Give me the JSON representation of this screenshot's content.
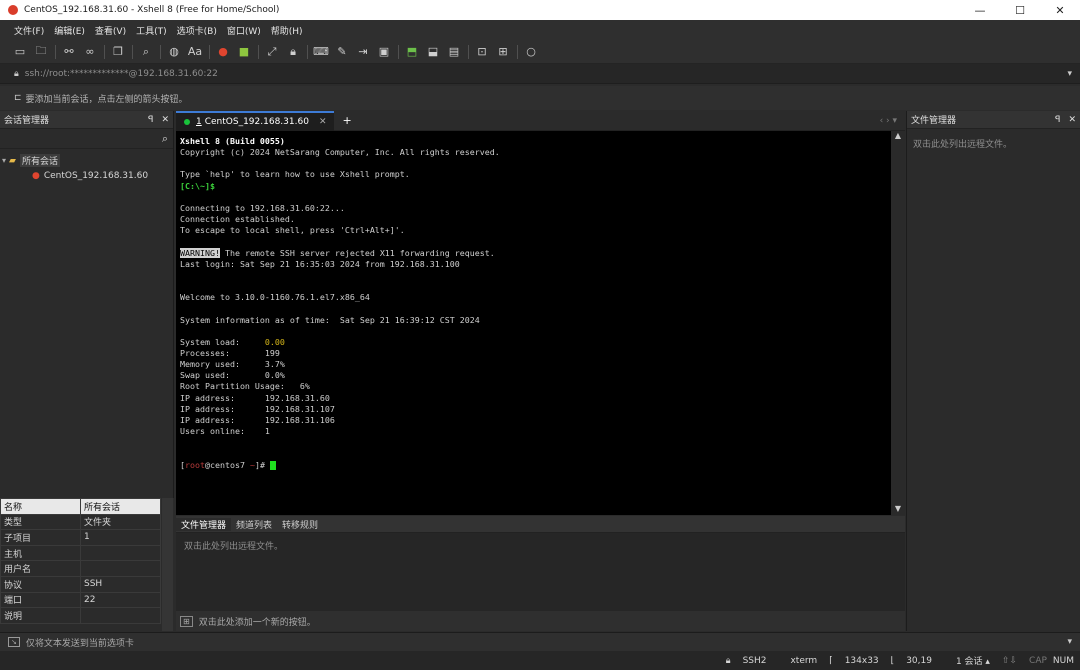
{
  "window": {
    "title": "CentOS_192.168.31.60 - Xshell 8 (Free for Home/School)",
    "minimize": "—",
    "maximize": "☐",
    "close": "✕"
  },
  "menu": [
    "文件(F)",
    "编辑(E)",
    "查看(V)",
    "工具(T)",
    "选项卡(B)",
    "窗口(W)",
    "帮助(H)"
  ],
  "toolbar": {
    "icons": [
      "new-session-icon",
      "open-folder-icon",
      "disconnect-icon",
      "reconnect-icon",
      "copy-icon",
      "find-icon",
      "globe-icon",
      "font-icon",
      "xshell-icon",
      "xftp-icon",
      "fullscreen-icon",
      "lock-icon",
      "keyboard-icon",
      "compose-icon",
      "script-icon",
      "help-icon",
      "transfer-icon",
      "tile-icon",
      "tabs-icon",
      "layout-icon",
      "chat-icon"
    ],
    "font_label": "Aa"
  },
  "address": {
    "value": "ssh://root:*************@192.168.31.60:22"
  },
  "hint": {
    "text": "要添加当前会话，点击左侧的箭头按钮。"
  },
  "session_manager": {
    "title": "会话管理器",
    "tree": {
      "root": "所有会话",
      "items": [
        "CentOS_192.168.31.60"
      ]
    }
  },
  "properties": {
    "header": [
      "名称",
      "所有会话"
    ],
    "rows": [
      [
        "类型",
        "文件夹"
      ],
      [
        "子项目",
        "1"
      ],
      [
        "主机",
        ""
      ],
      [
        "用户名",
        ""
      ],
      [
        "协议",
        "SSH"
      ],
      [
        "端口",
        "22"
      ],
      [
        "说明",
        ""
      ]
    ]
  },
  "tab": {
    "index": "1",
    "label": "CentOS_192.168.31.60",
    "add": "+"
  },
  "terminal": {
    "lines": [
      {
        "t": "Xshell 8 (Build 0055)",
        "c": "b"
      },
      {
        "t": "Copyright (c) 2024 NetSarang Computer, Inc. All rights reserved.",
        "c": ""
      },
      {
        "t": "",
        "c": ""
      },
      {
        "t": "Type `help' to learn how to use Xshell prompt.",
        "c": ""
      },
      {
        "t": "[C:\\~]$",
        "c": "g"
      },
      {
        "t": "",
        "c": ""
      },
      {
        "t": "Connecting to 192.168.31.60:22...",
        "c": ""
      },
      {
        "t": "Connection established.",
        "c": ""
      },
      {
        "t": "To escape to local shell, press 'Ctrl+Alt+]'.",
        "c": ""
      },
      {
        "t": "",
        "c": ""
      },
      {
        "t": "WARNING! The remote SSH server rejected X11 forwarding request.",
        "c": "warn"
      },
      {
        "t": "Last login: Sat Sep 21 16:35:03 2024 from 192.168.31.100",
        "c": ""
      },
      {
        "t": "",
        "c": ""
      },
      {
        "t": "",
        "c": ""
      },
      {
        "t": "Welcome to 3.10.0-1160.76.1.el7.x86_64",
        "c": ""
      },
      {
        "t": "",
        "c": ""
      },
      {
        "t": "System information as of time:  Sat Sep 21 16:39:12 CST 2024",
        "c": ""
      },
      {
        "t": "",
        "c": ""
      },
      {
        "t": "System load:     0.00",
        "c": "load"
      },
      {
        "t": "Processes:       199",
        "c": ""
      },
      {
        "t": "Memory used:     3.7%",
        "c": ""
      },
      {
        "t": "Swap used:       0.0%",
        "c": ""
      },
      {
        "t": "Root Partition Usage:   6%",
        "c": ""
      },
      {
        "t": "IP address:      192.168.31.60",
        "c": ""
      },
      {
        "t": "IP address:      192.168.31.107",
        "c": ""
      },
      {
        "t": "IP address:      192.168.31.106",
        "c": ""
      },
      {
        "t": "Users online:    1",
        "c": ""
      },
      {
        "t": "",
        "c": ""
      },
      {
        "t": "",
        "c": ""
      },
      {
        "t": "[root@centos7 ~]# ",
        "c": "prompt"
      }
    ]
  },
  "bottom_panel": {
    "tabs": [
      "文件管理器",
      "频道列表",
      "转移规则"
    ],
    "empty_text": "双击此处列出远程文件。",
    "add_button_text": "双击此处添加一个新的按钮。"
  },
  "file_manager": {
    "title": "文件管理器",
    "empty_text": "双击此处列出远程文件。"
  },
  "send_bar": {
    "text": "仅将文本发送到当前选项卡"
  },
  "status": {
    "protocol": "SSH2",
    "term": "xterm",
    "size": "134x33",
    "cursor": "30,19",
    "sessions": "1 会话",
    "caps": "CAP",
    "num": "NUM"
  }
}
